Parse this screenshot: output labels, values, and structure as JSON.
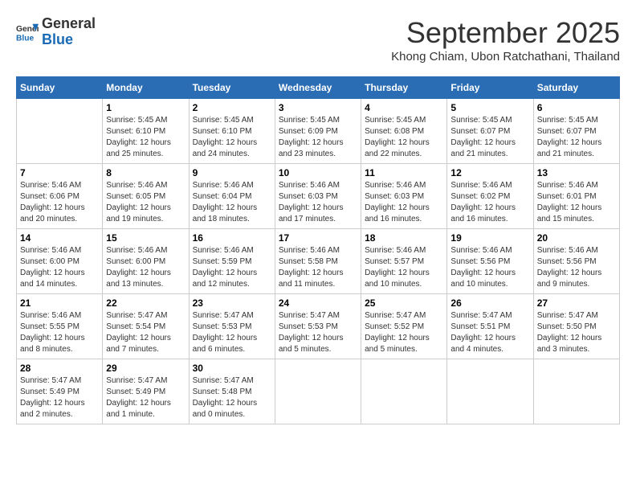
{
  "header": {
    "logo_line1": "General",
    "logo_line2": "Blue",
    "month": "September 2025",
    "location": "Khong Chiam, Ubon Ratchathani, Thailand"
  },
  "weekdays": [
    "Sunday",
    "Monday",
    "Tuesday",
    "Wednesday",
    "Thursday",
    "Friday",
    "Saturday"
  ],
  "weeks": [
    [
      {
        "day": "",
        "info": ""
      },
      {
        "day": "1",
        "info": "Sunrise: 5:45 AM\nSunset: 6:10 PM\nDaylight: 12 hours\nand 25 minutes."
      },
      {
        "day": "2",
        "info": "Sunrise: 5:45 AM\nSunset: 6:10 PM\nDaylight: 12 hours\nand 24 minutes."
      },
      {
        "day": "3",
        "info": "Sunrise: 5:45 AM\nSunset: 6:09 PM\nDaylight: 12 hours\nand 23 minutes."
      },
      {
        "day": "4",
        "info": "Sunrise: 5:45 AM\nSunset: 6:08 PM\nDaylight: 12 hours\nand 22 minutes."
      },
      {
        "day": "5",
        "info": "Sunrise: 5:45 AM\nSunset: 6:07 PM\nDaylight: 12 hours\nand 21 minutes."
      },
      {
        "day": "6",
        "info": "Sunrise: 5:45 AM\nSunset: 6:07 PM\nDaylight: 12 hours\nand 21 minutes."
      }
    ],
    [
      {
        "day": "7",
        "info": "Sunrise: 5:46 AM\nSunset: 6:06 PM\nDaylight: 12 hours\nand 20 minutes."
      },
      {
        "day": "8",
        "info": "Sunrise: 5:46 AM\nSunset: 6:05 PM\nDaylight: 12 hours\nand 19 minutes."
      },
      {
        "day": "9",
        "info": "Sunrise: 5:46 AM\nSunset: 6:04 PM\nDaylight: 12 hours\nand 18 minutes."
      },
      {
        "day": "10",
        "info": "Sunrise: 5:46 AM\nSunset: 6:03 PM\nDaylight: 12 hours\nand 17 minutes."
      },
      {
        "day": "11",
        "info": "Sunrise: 5:46 AM\nSunset: 6:03 PM\nDaylight: 12 hours\nand 16 minutes."
      },
      {
        "day": "12",
        "info": "Sunrise: 5:46 AM\nSunset: 6:02 PM\nDaylight: 12 hours\nand 16 minutes."
      },
      {
        "day": "13",
        "info": "Sunrise: 5:46 AM\nSunset: 6:01 PM\nDaylight: 12 hours\nand 15 minutes."
      }
    ],
    [
      {
        "day": "14",
        "info": "Sunrise: 5:46 AM\nSunset: 6:00 PM\nDaylight: 12 hours\nand 14 minutes."
      },
      {
        "day": "15",
        "info": "Sunrise: 5:46 AM\nSunset: 6:00 PM\nDaylight: 12 hours\nand 13 minutes."
      },
      {
        "day": "16",
        "info": "Sunrise: 5:46 AM\nSunset: 5:59 PM\nDaylight: 12 hours\nand 12 minutes."
      },
      {
        "day": "17",
        "info": "Sunrise: 5:46 AM\nSunset: 5:58 PM\nDaylight: 12 hours\nand 11 minutes."
      },
      {
        "day": "18",
        "info": "Sunrise: 5:46 AM\nSunset: 5:57 PM\nDaylight: 12 hours\nand 10 minutes."
      },
      {
        "day": "19",
        "info": "Sunrise: 5:46 AM\nSunset: 5:56 PM\nDaylight: 12 hours\nand 10 minutes."
      },
      {
        "day": "20",
        "info": "Sunrise: 5:46 AM\nSunset: 5:56 PM\nDaylight: 12 hours\nand 9 minutes."
      }
    ],
    [
      {
        "day": "21",
        "info": "Sunrise: 5:46 AM\nSunset: 5:55 PM\nDaylight: 12 hours\nand 8 minutes."
      },
      {
        "day": "22",
        "info": "Sunrise: 5:47 AM\nSunset: 5:54 PM\nDaylight: 12 hours\nand 7 minutes."
      },
      {
        "day": "23",
        "info": "Sunrise: 5:47 AM\nSunset: 5:53 PM\nDaylight: 12 hours\nand 6 minutes."
      },
      {
        "day": "24",
        "info": "Sunrise: 5:47 AM\nSunset: 5:53 PM\nDaylight: 12 hours\nand 5 minutes."
      },
      {
        "day": "25",
        "info": "Sunrise: 5:47 AM\nSunset: 5:52 PM\nDaylight: 12 hours\nand 5 minutes."
      },
      {
        "day": "26",
        "info": "Sunrise: 5:47 AM\nSunset: 5:51 PM\nDaylight: 12 hours\nand 4 minutes."
      },
      {
        "day": "27",
        "info": "Sunrise: 5:47 AM\nSunset: 5:50 PM\nDaylight: 12 hours\nand 3 minutes."
      }
    ],
    [
      {
        "day": "28",
        "info": "Sunrise: 5:47 AM\nSunset: 5:49 PM\nDaylight: 12 hours\nand 2 minutes."
      },
      {
        "day": "29",
        "info": "Sunrise: 5:47 AM\nSunset: 5:49 PM\nDaylight: 12 hours\nand 1 minute."
      },
      {
        "day": "30",
        "info": "Sunrise: 5:47 AM\nSunset: 5:48 PM\nDaylight: 12 hours\nand 0 minutes."
      },
      {
        "day": "",
        "info": ""
      },
      {
        "day": "",
        "info": ""
      },
      {
        "day": "",
        "info": ""
      },
      {
        "day": "",
        "info": ""
      }
    ]
  ]
}
